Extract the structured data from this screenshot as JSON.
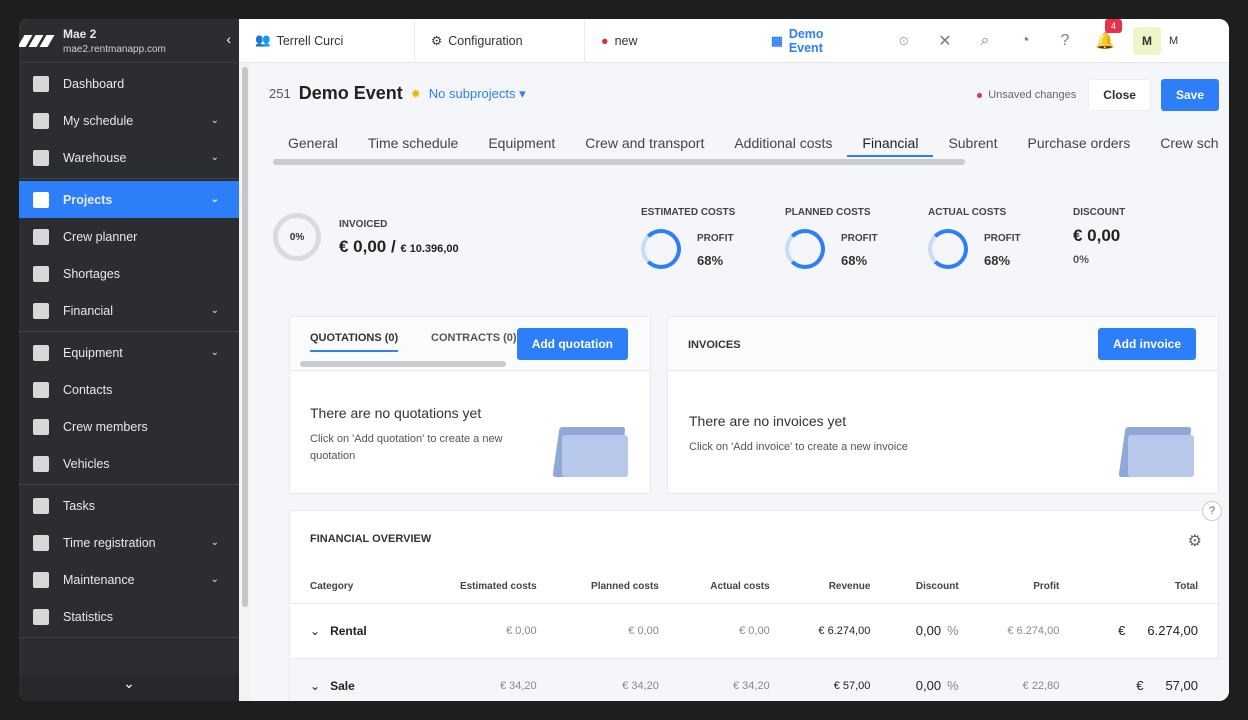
{
  "org": {
    "name": "Mae 2",
    "domain": "mae2.rentmanapp.com"
  },
  "sidebar": {
    "groups": [
      [
        {
          "label": "Dashboard",
          "chev": false,
          "icon": "dashboard-icon"
        },
        {
          "label": "My schedule",
          "chev": true,
          "icon": "calendar-icon"
        },
        {
          "label": "Warehouse",
          "chev": true,
          "icon": "warehouse-icon"
        }
      ],
      [
        {
          "label": "Projects",
          "chev": true,
          "icon": "projects-icon",
          "active": true
        },
        {
          "label": "Crew planner",
          "chev": false,
          "icon": "crew-planner-icon"
        },
        {
          "label": "Shortages",
          "chev": false,
          "icon": "shortages-icon"
        },
        {
          "label": "Financial",
          "chev": true,
          "icon": "financial-icon"
        }
      ],
      [
        {
          "label": "Equipment",
          "chev": true,
          "icon": "equipment-icon"
        },
        {
          "label": "Contacts",
          "chev": false,
          "icon": "contacts-icon"
        },
        {
          "label": "Crew members",
          "chev": false,
          "icon": "crew-members-icon"
        },
        {
          "label": "Vehicles",
          "chev": false,
          "icon": "vehicle-icon"
        }
      ],
      [
        {
          "label": "Tasks",
          "chev": false,
          "icon": "tasks-icon"
        },
        {
          "label": "Time registration",
          "chev": true,
          "icon": "clock-icon"
        },
        {
          "label": "Maintenance",
          "chev": true,
          "icon": "wrench-icon"
        },
        {
          "label": "Statistics",
          "chev": false,
          "icon": "statistics-icon"
        }
      ]
    ]
  },
  "topbar": {
    "user_tab": "Terrell Curci",
    "config_tab": "Configuration",
    "new_tab": "new",
    "event_tab": "Demo Event",
    "notification_count": "4",
    "avatar": "M",
    "avatar_extra": "M"
  },
  "project": {
    "number": "251",
    "title": "Demo Event",
    "subprojects": "No subprojects",
    "unsaved": "Unsaved changes",
    "close": "Close",
    "save": "Save"
  },
  "tabs": [
    "General",
    "Time schedule",
    "Equipment",
    "Crew and transport",
    "Additional costs",
    "Financial",
    "Subrent",
    "Purchase orders",
    "Crew sch"
  ],
  "summary": {
    "invoiced_pct": "0%",
    "invoiced_label": "INVOICED",
    "invoiced_value": "€ 0,00 /",
    "invoiced_total": "€ 10.396,00",
    "costs": [
      {
        "label": "ESTIMATED COSTS",
        "profit_label": "PROFIT",
        "profit": "68%"
      },
      {
        "label": "PLANNED COSTS",
        "profit_label": "PROFIT",
        "profit": "68%"
      },
      {
        "label": "ACTUAL COSTS",
        "profit_label": "PROFIT",
        "profit": "68%"
      }
    ],
    "discount_label": "DISCOUNT",
    "discount_value": "€ 0,00",
    "discount_pct": "0%"
  },
  "quotations": {
    "tab_quotations": "QUOTATIONS (0)",
    "tab_contracts": "CONTRACTS (0)",
    "add": "Add quotation",
    "empty_title": "There are no quotations yet",
    "empty_sub": "Click on 'Add quotation' to create a new quotation"
  },
  "invoices": {
    "title": "INVOICES",
    "add": "Add invoice",
    "empty_title": "There are no invoices yet",
    "empty_sub": "Click on 'Add invoice' to create a new invoice"
  },
  "overview": {
    "title": "FINANCIAL OVERVIEW",
    "columns": [
      "Category",
      "Estimated costs",
      "Planned costs",
      "Actual costs",
      "Revenue",
      "Discount",
      "Profit",
      "Total"
    ],
    "rows": [
      {
        "category": "Rental",
        "estimated": "€ 0,00",
        "planned": "€ 0,00",
        "actual": "€ 0,00",
        "revenue": "€ 6.274,00",
        "discount": "0,00",
        "discount_unit": "%",
        "profit": "€ 6.274,00",
        "total_currency": "€",
        "total": "6.274,00"
      },
      {
        "category": "Sale",
        "estimated": "€ 34,20",
        "planned": "€ 34,20",
        "actual": "€ 34,20",
        "revenue": "€ 57,00",
        "discount": "0,00",
        "discount_unit": "%",
        "profit": "€ 22,80",
        "total_currency": "€",
        "total": "57,00"
      }
    ]
  }
}
